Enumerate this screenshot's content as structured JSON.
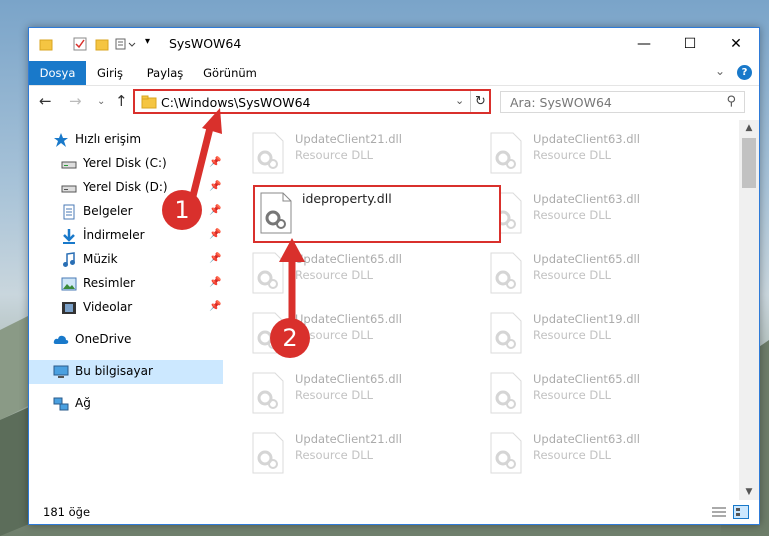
{
  "window": {
    "title": "SysWOW64"
  },
  "ribbon": {
    "tabs": [
      {
        "label": "Dosya",
        "active": true
      },
      {
        "label": "Giriş"
      },
      {
        "label": "Paylaş"
      },
      {
        "label": "Görünüm"
      }
    ],
    "help": "?"
  },
  "nav": {
    "address": "C:\\Windows\\SysWOW64",
    "search_placeholder": "Ara: SysWOW64"
  },
  "sidebar": {
    "items": [
      {
        "label": "Hızlı erişim",
        "icon": "star-icon"
      },
      {
        "label": "Yerel Disk (C:)",
        "icon": "drive-icon"
      },
      {
        "label": "Yerel Disk (D:)",
        "icon": "drive-icon"
      },
      {
        "label": "Belgeler",
        "icon": "documents-icon"
      },
      {
        "label": "İndirmeler",
        "icon": "download-icon"
      },
      {
        "label": "Müzik",
        "icon": "music-icon"
      },
      {
        "label": "Resimler",
        "icon": "pictures-icon"
      },
      {
        "label": "Videolar",
        "icon": "video-icon"
      },
      {
        "label": "OneDrive",
        "icon": "cloud-icon"
      },
      {
        "label": "Bu bilgisayar",
        "icon": "computer-icon"
      },
      {
        "label": "Ağ",
        "icon": "network-icon"
      }
    ]
  },
  "files": {
    "highlighted": "ideproperty.dll",
    "desc": "Resource DLL",
    "left_col": [
      "UpdateClient21.dll",
      "UpdateClient65.dll",
      "UpdateClient65.dll",
      "UpdateClient65.dll",
      "UpdateClient21.dll"
    ],
    "right_col": [
      "UpdateClient63.dll",
      "UpdateClient63.dll",
      "UpdateClient65.dll",
      "UpdateClient19.dll",
      "UpdateClient65.dll",
      "UpdateClient63.dll"
    ]
  },
  "status": {
    "count": "181 öğe"
  },
  "callouts": [
    "1",
    "2"
  ],
  "colors": {
    "accent": "#1979ca",
    "highlight": "#d9302c"
  }
}
